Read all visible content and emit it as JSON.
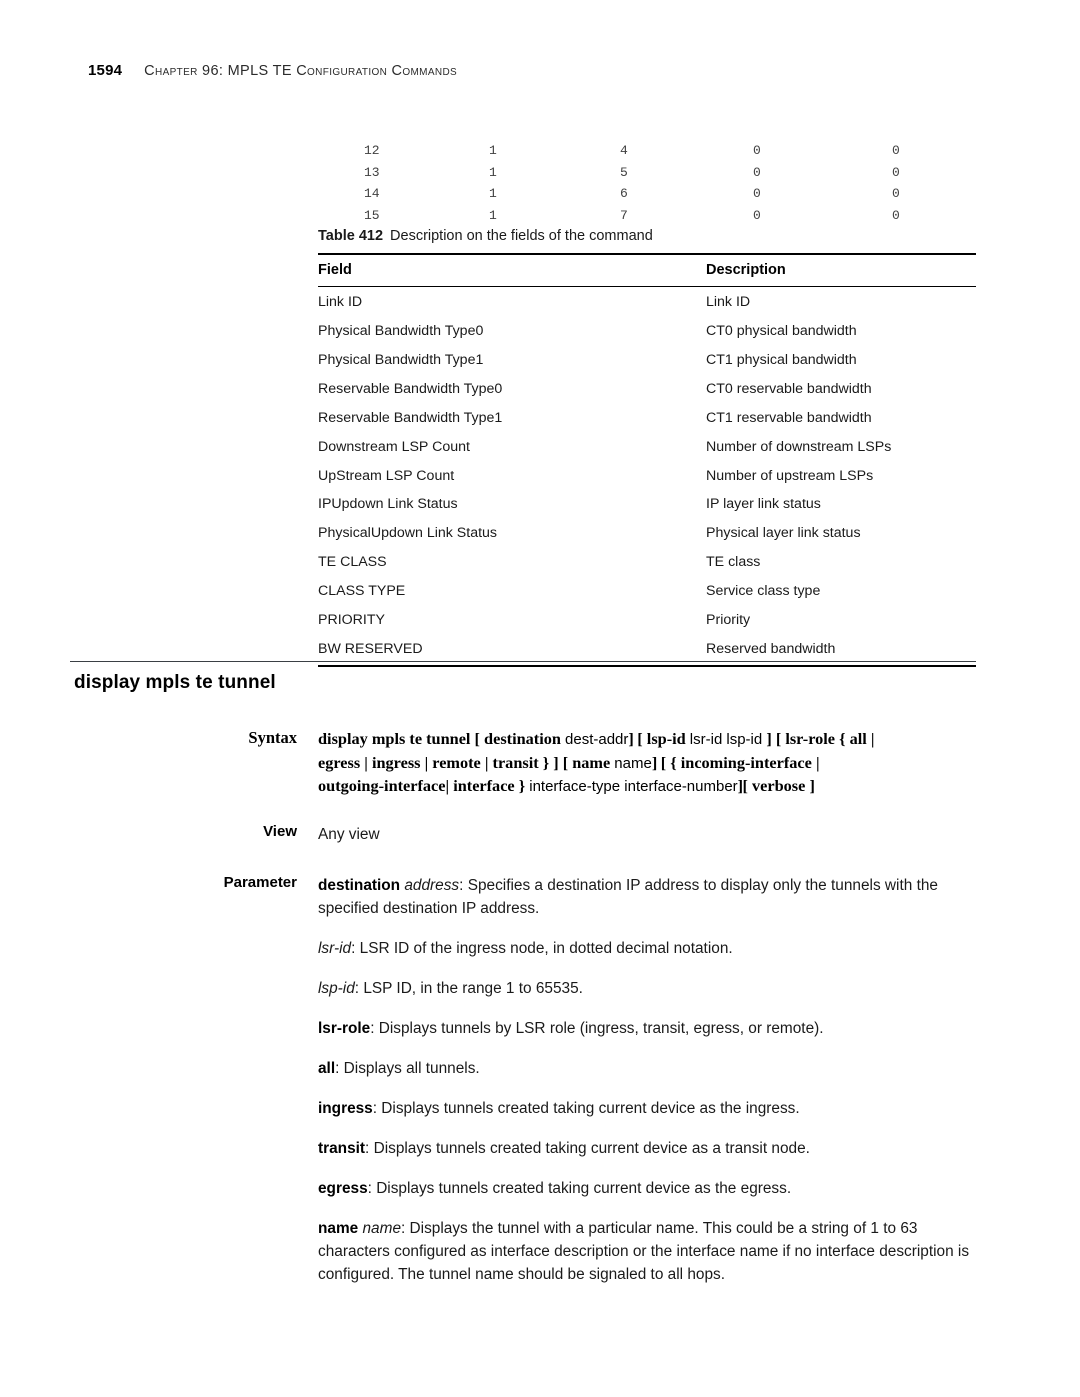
{
  "header": {
    "page_number": "1594",
    "title": "Chapter 96: MPLS TE Configuration Commands"
  },
  "code_output": {
    "rows": [
      [
        "12",
        "1",
        "4",
        "0",
        "0"
      ],
      [
        "13",
        "1",
        "5",
        "0",
        "0"
      ],
      [
        "14",
        "1",
        "6",
        "0",
        "0"
      ],
      [
        "15",
        "1",
        "7",
        "0",
        "0"
      ]
    ]
  },
  "table": {
    "caption_label": "Table 412",
    "caption_text": "Description on the fields of the command",
    "headers": [
      "Field",
      "Description"
    ],
    "rows": [
      [
        "Link ID",
        "Link ID"
      ],
      [
        "Physical Bandwidth Type0",
        "CT0 physical bandwidth"
      ],
      [
        "Physical Bandwidth Type1",
        "CT1 physical bandwidth"
      ],
      [
        "Reservable Bandwidth Type0",
        "CT0 reservable bandwidth"
      ],
      [
        "Reservable Bandwidth Type1",
        "CT1 reservable bandwidth"
      ],
      [
        "Downstream LSP Count",
        "Number of downstream LSPs"
      ],
      [
        "UpStream LSP Count",
        "Number of upstream LSPs"
      ],
      [
        "IPUpdown Link Status",
        "IP layer link status"
      ],
      [
        "PhysicalUpdown Link Status",
        "Physical layer link status"
      ],
      [
        "TE CLASS",
        "TE class"
      ],
      [
        "CLASS TYPE",
        "Service class type"
      ],
      [
        "PRIORITY",
        "Priority"
      ],
      [
        "BW RESERVED",
        "Reserved bandwidth"
      ]
    ]
  },
  "section": {
    "heading": "display mpls te tunnel"
  },
  "syntax": {
    "label": "Syntax",
    "line1": {
      "kw1": "display mpls te tunnel",
      "b1": "[",
      "kw2": "destination",
      "v1": "dest-addr",
      "b2": "]",
      "b3": "[",
      "kw3": "lsp-id",
      "v2": "lsr-id",
      "v3": "lsp-id",
      "b4": "]",
      "b5": "[",
      "kw4": "lsr-role",
      "b6": "{",
      "kw5": "all",
      "b7": "|"
    },
    "line2": {
      "kw1": "egress",
      "b1": "|",
      "kw2": "ingress",
      "b2": "|",
      "kw3": "remote",
      "b3": "|",
      "kw4": "transit",
      "b4": "}",
      "b5": "]",
      "b6": "[",
      "kw5": "name",
      "v1": "name",
      "b7": "]",
      "b8": "[",
      "b9": "{",
      "kw6": "incoming-interface",
      "b10": "|"
    },
    "line3": {
      "kw1": "outgoing-interface",
      "b1": "|",
      "kw2": "interface",
      "b2": "}",
      "v1": "interface-type interface-number",
      "b3": "]",
      "b4": "[",
      "kw3": "verbose",
      "b5": "]"
    }
  },
  "view": {
    "label": "View",
    "value": "Any view"
  },
  "parameter": {
    "label": "Parameter",
    "entries": [
      {
        "term": "destination",
        "term_style": "bold",
        "arg": "address",
        "arg_style": "italic",
        "text": ": Specifies a destination IP address to display only the tunnels with the specified destination IP address."
      },
      {
        "term": "lsr-id",
        "term_style": "italic",
        "arg": "",
        "arg_style": "",
        "text": ": LSR ID of the ingress node, in dotted decimal notation."
      },
      {
        "term": "lsp-id",
        "term_style": "italic",
        "arg": "",
        "arg_style": "",
        "text": ": LSP ID, in the range 1 to 65535."
      },
      {
        "term": "lsr-role",
        "term_style": "bold",
        "arg": "",
        "arg_style": "",
        "text": ": Displays tunnels by LSR role (ingress, transit, egress, or remote)."
      },
      {
        "term": "all",
        "term_style": "bold",
        "arg": "",
        "arg_style": "",
        "text": ": Displays all tunnels."
      },
      {
        "term": "ingress",
        "term_style": "bold",
        "arg": "",
        "arg_style": "",
        "text": ": Displays tunnels created taking current device as the ingress."
      },
      {
        "term": "transit",
        "term_style": "bold",
        "arg": "",
        "arg_style": "",
        "text": ": Displays tunnels created taking current device as a transit node."
      },
      {
        "term": "egress",
        "term_style": "bold",
        "arg": "",
        "arg_style": "",
        "text": ": Displays tunnels created taking current device as the egress."
      },
      {
        "term": "name",
        "term_style": "bold",
        "arg": "name",
        "arg_style": "italic",
        "text": ": Displays the tunnel with a particular name. This could be a string of 1 to 63 characters configured as interface description or the interface name if no interface description is configured. The tunnel name should be signaled to all hops."
      }
    ]
  }
}
